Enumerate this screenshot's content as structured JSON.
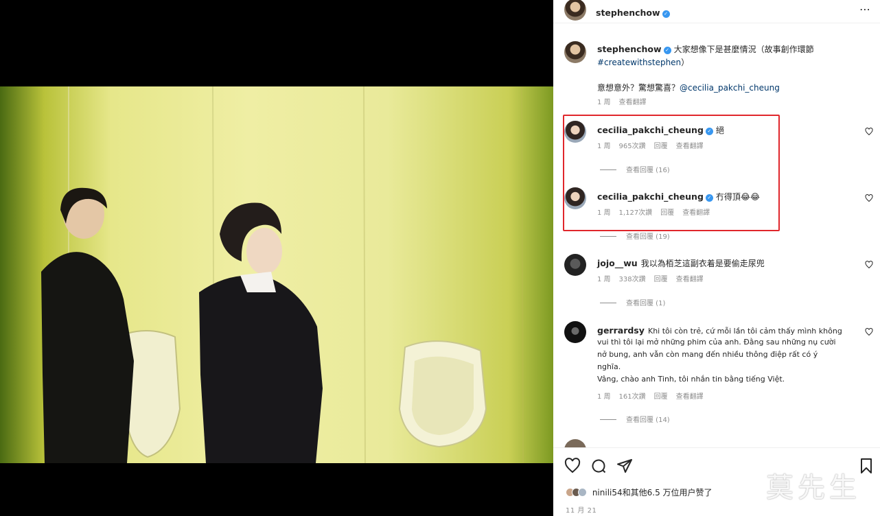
{
  "post": {
    "author": "stephenchow",
    "more_label": "⋯"
  },
  "caption": {
    "username": "stephenchow",
    "text": "大家想像下是甚麼情況（故事創作環節",
    "hashtag": "#createwithstephen",
    "close": "）",
    "line2_text": "意想意外？驚想驚喜？",
    "mention": "@cecilia_pakchi_cheung",
    "time": "1 周",
    "translate": "查看翻譯"
  },
  "comments": [
    {
      "username": "cecilia_pakchi_cheung",
      "text": "絕",
      "time": "1 周",
      "likes": "965次讚",
      "reply": "回覆",
      "translate": "查看翻譯",
      "view_replies": "查看回覆 (16)"
    },
    {
      "username": "cecilia_pakchi_cheung",
      "text": "冇得頂😂😂",
      "time": "1 周",
      "likes": "1,127次讚",
      "reply": "回覆",
      "translate": "查看翻譯",
      "view_replies": "查看回覆 (19)"
    },
    {
      "username": "jojo__wu",
      "text": "我以為栢芝這副衣着是要偷走尿兜",
      "time": "1 周",
      "likes": "338次讚",
      "reply": "回覆",
      "translate": "查看翻譯",
      "view_replies": "查看回覆 (1)"
    },
    {
      "username": "gerrardsy",
      "text_lines": [
        "Khi tôi còn trẻ, cứ mỗi lần tôi cảm thấy mình không",
        "vui thì tôi lại mở những phim của anh. Đằng sau những nụ cười",
        "nở bung, anh vẫn còn mang đến nhiều thông điệp rất có ý",
        "nghĩa.",
        "Vâng, chào anh Tinh, tôi nhắn tin bằng tiếng Việt."
      ],
      "time": "1 周",
      "likes": "161次讚",
      "reply": "回覆",
      "translate": "查看翻譯",
      "view_replies": "查看回覆 (14)"
    }
  ],
  "action_bar": {
    "likes_text": "ninili54和其他6.5 万位用户赞了",
    "date": "11 月 21"
  },
  "watermark": "莫先生",
  "colors": {
    "highlight": "#e0262b",
    "verified": "#3897f0",
    "link": "#00376b",
    "meta": "#8e8e8e"
  }
}
